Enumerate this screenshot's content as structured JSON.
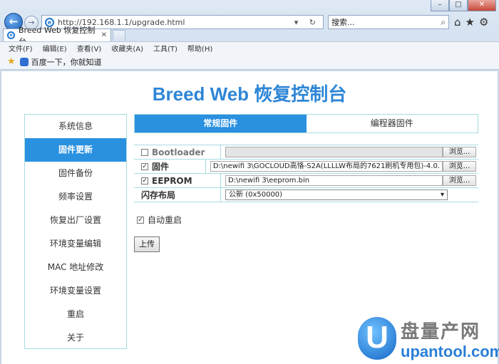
{
  "browser": {
    "address": "http://192.168.1.1/upgrade.html",
    "search_placeholder": "搜索...",
    "tab_title": "Breed Web 恢复控制台",
    "menu": [
      "文件(F)",
      "编辑(E)",
      "查看(V)",
      "收藏夹(A)",
      "工具(T)",
      "帮助(H)"
    ],
    "favorites_item": "百度一下，你就知道"
  },
  "page": {
    "brand": "Breed Web 恢复控制台",
    "sidebar": [
      {
        "label": "系统信息",
        "active": false
      },
      {
        "label": "固件更新",
        "active": true
      },
      {
        "label": "固件备份",
        "active": false
      },
      {
        "label": "频率设置",
        "active": false
      },
      {
        "label": "恢复出厂设置",
        "active": false
      },
      {
        "label": "环境变量编辑",
        "active": false
      },
      {
        "label": "MAC 地址修改",
        "active": false
      },
      {
        "label": "环境变量设置",
        "active": false
      },
      {
        "label": "重启",
        "active": false
      },
      {
        "label": "关于",
        "active": false
      }
    ],
    "tabs": [
      {
        "label": "常规固件",
        "active": true
      },
      {
        "label": "编程器固件",
        "active": false
      }
    ],
    "form": {
      "bootloader": {
        "label": "Bootloader",
        "checked": false,
        "value": "",
        "browse": "浏览..."
      },
      "firmware": {
        "label": "固件",
        "checked": true,
        "value": "D:\\newifi 3\\GOCLOUD高恪-S2A(LLLLW布局的7621刷机专用包)-4.0.",
        "browse": "浏览..."
      },
      "eeprom": {
        "label": "EEPROM",
        "checked": true,
        "value": "D:\\newifi 3\\eeprom.bin",
        "browse": "浏览..."
      },
      "flash_layout": {
        "label": "闪存布局",
        "selected": "公新 (0x50000)"
      }
    },
    "auto_reboot": {
      "label": "自动重启",
      "checked": true
    },
    "upload_label": "上传"
  },
  "watermark": {
    "letter": "U",
    "cn": "盘量产网",
    "en": "upantool.com"
  }
}
